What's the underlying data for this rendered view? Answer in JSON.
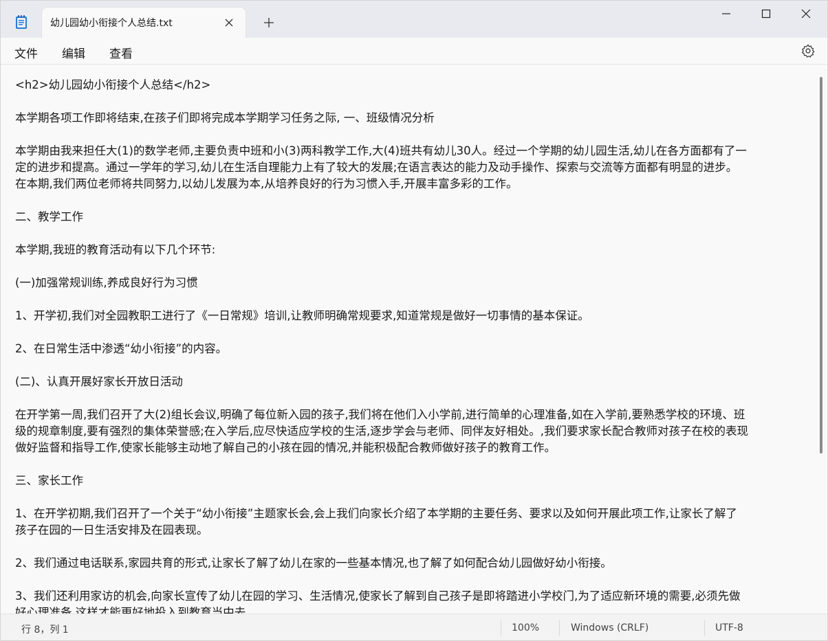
{
  "tab": {
    "title": "幼儿园幼小衔接个人总结.txt"
  },
  "menu": {
    "file": "文件",
    "edit": "编辑",
    "view": "查看"
  },
  "document": {
    "lines": [
      "<h2>幼儿园幼小衔接个人总结</h2>",
      "",
      "本学期各项工作即将结束,在孩子们即将完成本学期学习任务之际, 一、班级情况分析",
      "",
      "本学期由我来担任大(1)的数学老师,主要负责中班和小(3)两科教学工作,大(4)班共有幼儿30人。经过一个学期的幼儿园生活,幼儿在各方面都有了一",
      "定的进步和提高。通过一学年的学习,幼儿在生活自理能力上有了较大的发展;在语言表达的能力及动手操作、探索与交流等方面都有明显的进步。",
      "在本期,我们两位老师将共同努力,以幼儿发展为本,从培养良好的行为习惯入手,开展丰富多彩的工作。",
      "",
      "二、教学工作",
      "",
      "本学期,我班的教育活动有以下几个环节:",
      "",
      "(一)加强常规训练,养成良好行为习惯",
      "",
      "1、开学初,我们对全园教职工进行了《一日常规》培训,让教师明确常规要求,知道常规是做好一切事情的基本保证。",
      "",
      "2、在日常生活中渗透“幼小衔接”的内容。",
      "",
      "(二)、认真开展好家长开放日活动",
      "",
      "在开学第一周,我们召开了大(2)组长会议,明确了每位新入园的孩子,我们将在他们入小学前,进行简单的心理准备,如在入学前,要熟悉学校的环境、班",
      "级的规章制度,要有强烈的集体荣誉感;在入学后,应尽快适应学校的生活,逐步学会与老师、同伴友好相处。,我们要求家长配合教师对孩子在校的表现",
      "做好监督和指导工作,使家长能够主动地了解自己的小孩在园的情况,并能积极配合教师做好孩子的教育工作。",
      "",
      "三、家长工作",
      "",
      "1、在开学初期,我们召开了一个关于“幼小衔接”主题家长会,会上我们向家长介绍了本学期的主要任务、要求以及如何开展此项工作,让家长了解了",
      "孩子在园的一日生活安排及在园表现。",
      "",
      "2、我们通过电话联系,家园共育的形式,让家长了解了幼儿在家的一些基本情况,也了解了如何配合幼儿园做好幼小衔接。",
      "",
      "3、我们还利用家访的机会,向家长宣传了幼儿在园的学习、生活情况,使家长了解到自己孩子是即将踏进小学校门,为了适应新环境的需要,必须先做",
      "好心理准备,这样才能更好地投入到教育当中去。"
    ]
  },
  "status": {
    "position": "行 8，列 1",
    "zoom": "100%",
    "line_ending": "Windows (CRLF)",
    "encoding": "UTF-8"
  },
  "icons": {
    "app": "notepad-icon",
    "tab_close": "close-icon",
    "new_tab": "plus-icon",
    "minimize": "minimize-icon",
    "maximize": "maximize-icon",
    "close": "close-icon",
    "settings": "gear-icon"
  },
  "colors": {
    "titlebar": "#e8eaef",
    "editor_bg": "#f9f9f9",
    "text": "#1a1a1a"
  }
}
